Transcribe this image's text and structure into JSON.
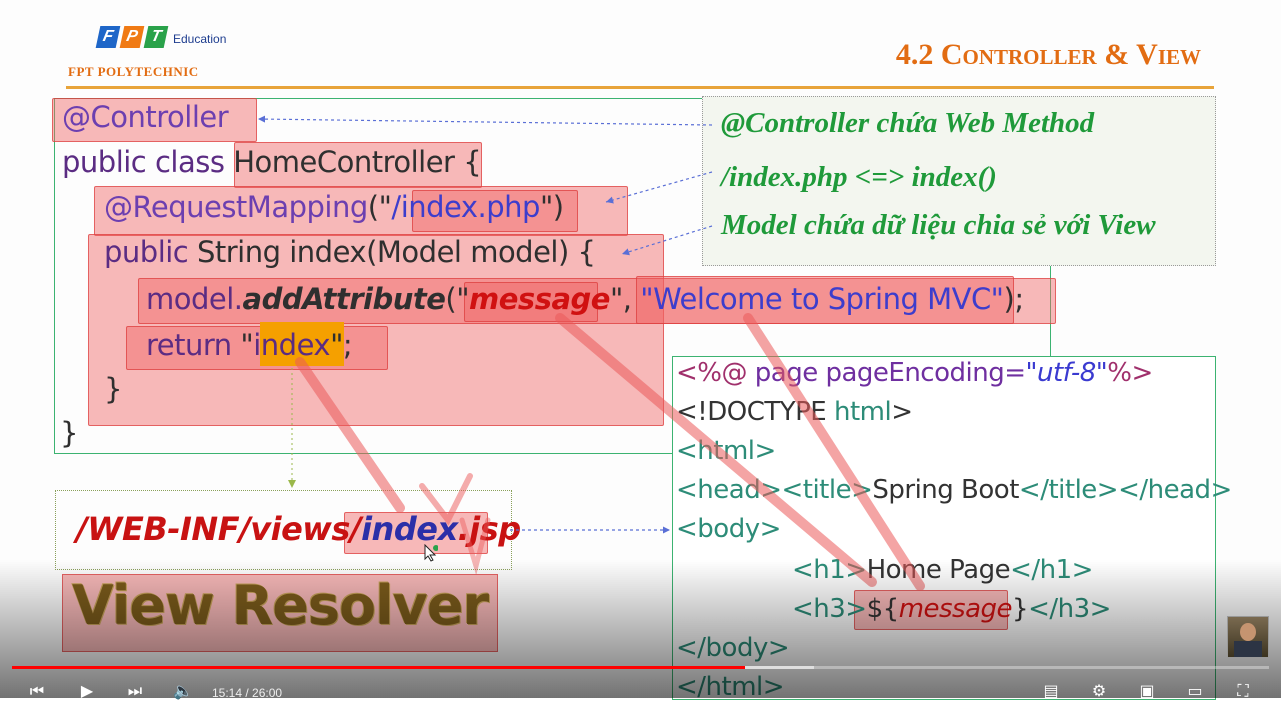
{
  "header": {
    "logo_letters": [
      "F",
      "P",
      "T"
    ],
    "logo_suffix": "Education",
    "school": "FPT POLYTECHNIC",
    "slide_title": "4.2 Controller & View"
  },
  "code": {
    "l1": "@Controller",
    "l2_kw": "public class ",
    "l2_name": "HomeController",
    "l2_end": " {",
    "l3_ann": "@RequestMapping",
    "l3_open": "(\"",
    "l3_path": "/index.php",
    "l3_close": "\")",
    "l4_kw": "public ",
    "l4_rest": "String index(Model model) {",
    "l5_obj": "model.",
    "l5_method": "addAttribute",
    "l5_open": "(\"",
    "l5_key": "message",
    "l5_mid": "\", ",
    "l5_val": "\"Welcome to Spring MVC\"",
    "l5_end": ");",
    "l6_kw": "return ",
    "l6_q1": "\"",
    "l6_val": "index",
    "l6_q2": "\";",
    "l7": "}",
    "l8": "}"
  },
  "notes": {
    "n1": "@Controller chứa Web Method",
    "n2": "/index.php <=> index()",
    "n3": "Model chứa dữ liệu chia sẻ với View"
  },
  "resolver": {
    "path_prefix": "/WEB-INF/views/",
    "path_name": "index",
    "path_ext": ".jsp",
    "label": "View Resolver"
  },
  "jsp": {
    "j1_open": "<%@ ",
    "j1_dir": "page ",
    "j1_attr": "pageEncoding=",
    "j1_val": "\"utf-8\"",
    "j1_close": "%>",
    "j2_open": "<!DOCTYPE ",
    "j2_name": "html",
    "j2_close": ">",
    "j3": "<html>",
    "j4_a": "<head><title>",
    "j4_text": "Spring Boot",
    "j4_b": "</title></head>",
    "j5": "<body>",
    "j6_a": "<h1>",
    "j6_text": "Home Page",
    "j6_b": "</h1>",
    "j7_a": "<h3>",
    "j7_open": "${",
    "j7_var": "message",
    "j7_close": "}",
    "j7_b": "</h3>",
    "j8": "</body>",
    "j9": "</html>"
  },
  "player": {
    "time": "15:14 / 26:00",
    "progress_fraction": 0.583,
    "buffer_fraction": 0.638,
    "icons": [
      "skip-previous-icon",
      "play-icon",
      "skip-next-icon",
      "volume-icon",
      "subtitles-icon",
      "settings-icon",
      "miniplayer-icon",
      "theater-icon",
      "fullscreen-icon"
    ]
  },
  "colors": {
    "accent_orange": "#e26c12",
    "note_green": "#1f9a3a",
    "highlight_red": "#f06464",
    "progress_red": "#ff0000"
  }
}
